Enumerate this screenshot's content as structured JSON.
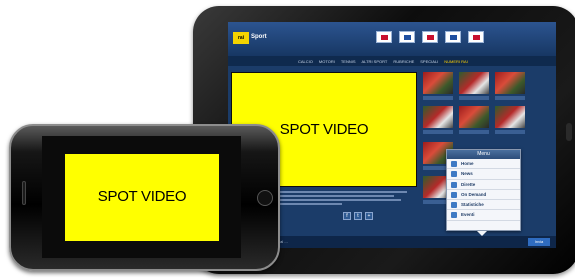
{
  "tablet": {
    "brand": "Sport",
    "logo": "rai",
    "nav": [
      "CALCIO",
      "MOTORI",
      "TENNIS",
      "ALTRI SPORT",
      "RUBRICHE",
      "SPECIALI",
      "NUMERI RAI"
    ],
    "video_label": "SPOT VIDEO",
    "rating": [
      "★",
      "★",
      "★",
      "★",
      "☆"
    ],
    "actions": [
      "f",
      "t",
      "+"
    ],
    "footer_text": "Champions: Inter-Villarreal ... ",
    "footer_button": "Invia",
    "menu": {
      "title": "Menu",
      "items": [
        {
          "label": "Home",
          "icon": "home-icon"
        },
        {
          "label": "News",
          "icon": "news-icon"
        },
        {
          "label": "Dirette",
          "icon": "live-icon"
        },
        {
          "label": "On Demand",
          "icon": "play-icon"
        },
        {
          "label": "Statistiche",
          "icon": "stats-icon"
        },
        {
          "label": "Eventi",
          "icon": "calendar-icon"
        }
      ]
    }
  },
  "phone": {
    "video_label": "SPOT VIDEO"
  },
  "colors": {
    "video": "#ffff00",
    "tablet_header": "#1b3c69",
    "accent": "#ffd200"
  }
}
